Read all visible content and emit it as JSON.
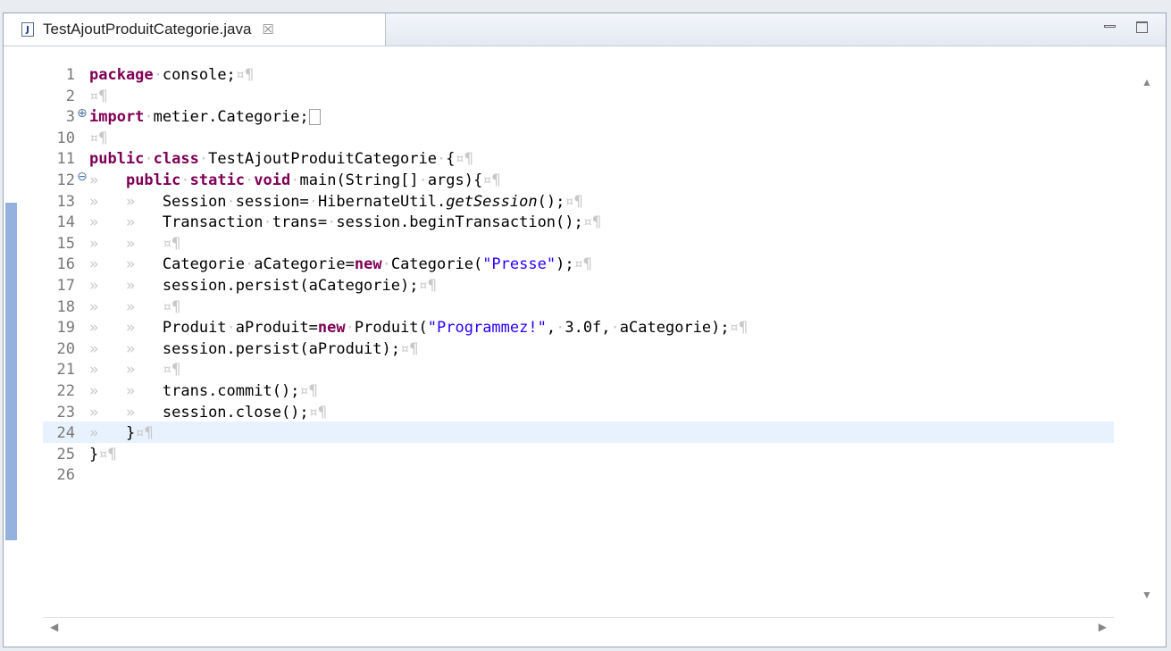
{
  "tab": {
    "title": "TestAjoutProduitCategorie.java",
    "close": "☒",
    "icon_letter": "J"
  },
  "scroll": {
    "up": "▲",
    "down": "▼",
    "left": "◀",
    "right": "▶"
  },
  "lines": [
    {
      "num": "1",
      "fold": "",
      "cur": false,
      "html": "<span class='kw'>package</span><span class='ws'>·</span>console;<span class='ws'>¤¶</span>"
    },
    {
      "num": "2",
      "fold": "",
      "cur": false,
      "html": "<span class='ws'>¤¶</span>"
    },
    {
      "num": "3",
      "fold": "⊕",
      "cur": false,
      "html": "<span class='kw'>import</span><span class='ws'>·</span>metier.Categorie;<span class='boxed'></span>"
    },
    {
      "num": "10",
      "fold": "",
      "cur": false,
      "html": "<span class='ws'>¤¶</span>"
    },
    {
      "num": "11",
      "fold": "",
      "cur": false,
      "html": "<span class='kw'>public</span><span class='ws'>·</span><span class='kw'>class</span><span class='ws'>·</span>TestAjoutProduitCategorie<span class='ws'>·</span>{<span class='ws'>¤¶</span>"
    },
    {
      "num": "12",
      "fold": "⊖",
      "cur": false,
      "html": "<span class='ws'>»   </span><span class='kw'>public</span><span class='ws'>·</span><span class='kw'>static</span><span class='ws'>·</span><span class='kw'>void</span><span class='ws'>·</span>main(String[]<span class='ws'>·</span>args){<span class='ws'>¤¶</span>"
    },
    {
      "num": "13",
      "fold": "",
      "cur": false,
      "html": "<span class='ws'>»   »   </span>Session<span class='ws'>·</span>session=<span class='ws'>·</span>HibernateUtil.<span class='ital'>getSession</span>();<span class='ws'>¤¶</span>"
    },
    {
      "num": "14",
      "fold": "",
      "cur": false,
      "html": "<span class='ws'>»   »   </span>Transaction<span class='ws'>·</span>trans=<span class='ws'>·</span>session.beginTransaction();<span class='ws'>¤¶</span>"
    },
    {
      "num": "15",
      "fold": "",
      "cur": false,
      "html": "<span class='ws'>»   »   ¤¶</span>"
    },
    {
      "num": "16",
      "fold": "",
      "cur": false,
      "html": "<span class='ws'>»   »   </span>Categorie<span class='ws'>·</span>aCategorie=<span class='kw'>new</span><span class='ws'>·</span>Categorie(<span class='str'>\"Presse\"</span>);<span class='ws'>¤¶</span>"
    },
    {
      "num": "17",
      "fold": "",
      "cur": false,
      "html": "<span class='ws'>»   »   </span>session.persist(aCategorie);<span class='ws'>¤¶</span>"
    },
    {
      "num": "18",
      "fold": "",
      "cur": false,
      "html": "<span class='ws'>»   »   ¤¶</span>"
    },
    {
      "num": "19",
      "fold": "",
      "cur": false,
      "html": "<span class='ws'>»   »   </span>Produit<span class='ws'>·</span>aProduit=<span class='kw'>new</span><span class='ws'>·</span>Produit(<span class='str'>\"Programmez!\"</span>,<span class='ws'>·</span>3.0f,<span class='ws'>·</span>aCategorie);<span class='ws'>¤¶</span>"
    },
    {
      "num": "20",
      "fold": "",
      "cur": false,
      "html": "<span class='ws'>»   »   </span>session.persist(aProduit);<span class='ws'>¤¶</span>"
    },
    {
      "num": "21",
      "fold": "",
      "cur": false,
      "html": "<span class='ws'>»   »   ¤¶</span>"
    },
    {
      "num": "22",
      "fold": "",
      "cur": false,
      "html": "<span class='ws'>»   »   </span>trans.commit();<span class='ws'>¤¶</span>"
    },
    {
      "num": "23",
      "fold": "",
      "cur": false,
      "html": "<span class='ws'>»   »   </span>session.close();<span class='ws'>¤¶</span>"
    },
    {
      "num": "24",
      "fold": "",
      "cur": true,
      "html": "<span class='ws'>»   </span>}<span class='ws'>¤¶</span>"
    },
    {
      "num": "25",
      "fold": "",
      "cur": false,
      "html": "}<span class='ws'>¤¶</span>"
    },
    {
      "num": "26",
      "fold": "",
      "cur": false,
      "html": ""
    }
  ],
  "colors": {
    "keyword": "#7f0055",
    "string": "#2a00ff",
    "whitespace": "#c8c8c8",
    "current_line": "#e8f2fe"
  }
}
